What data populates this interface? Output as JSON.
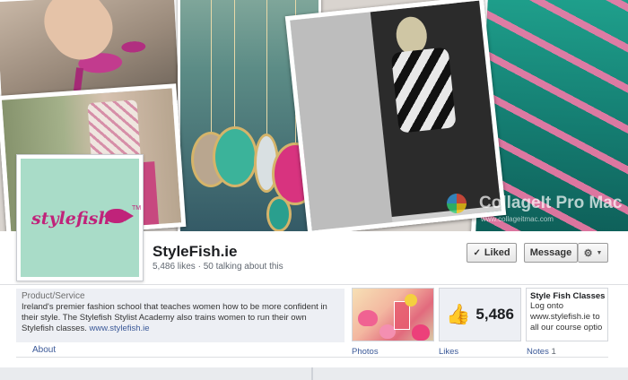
{
  "page": {
    "name": "StyleFish.ie",
    "stats": "5,486 likes · 50 talking about this"
  },
  "actions": {
    "liked_label": "Liked",
    "message_label": "Message"
  },
  "profile": {
    "logo_text": "stylefish",
    "logo_tm": "TM"
  },
  "about": {
    "category": "Product/Service",
    "description": "Ireland's premier fashion school that teaches women how to be more confident in their style. The Stylefish Stylist Academy also trains women to run their own Stylefish classes.",
    "url": "www.stylefish.ie",
    "link_label": "About"
  },
  "apps": {
    "photos_label": "Photos",
    "likes_label": "Likes",
    "likes_count": "5,486",
    "notes_label": "Notes",
    "notes_count": "1",
    "notes_title": "Style Fish Classes",
    "notes_line1": "Log onto",
    "notes_line2": "www.stylefish.ie to",
    "notes_line3": "all our course optio"
  },
  "watermark": {
    "text": "CollageIt Pro Mac",
    "url": "www.collageitmac.com"
  },
  "colors": {
    "brand_blue": "#3b5998",
    "logo_pink": "#c0237a",
    "logo_bg": "#a9dcc8"
  },
  "icons": [
    "check-icon",
    "gear-icon",
    "chevron-down-icon",
    "thumbs-up-icon"
  ]
}
